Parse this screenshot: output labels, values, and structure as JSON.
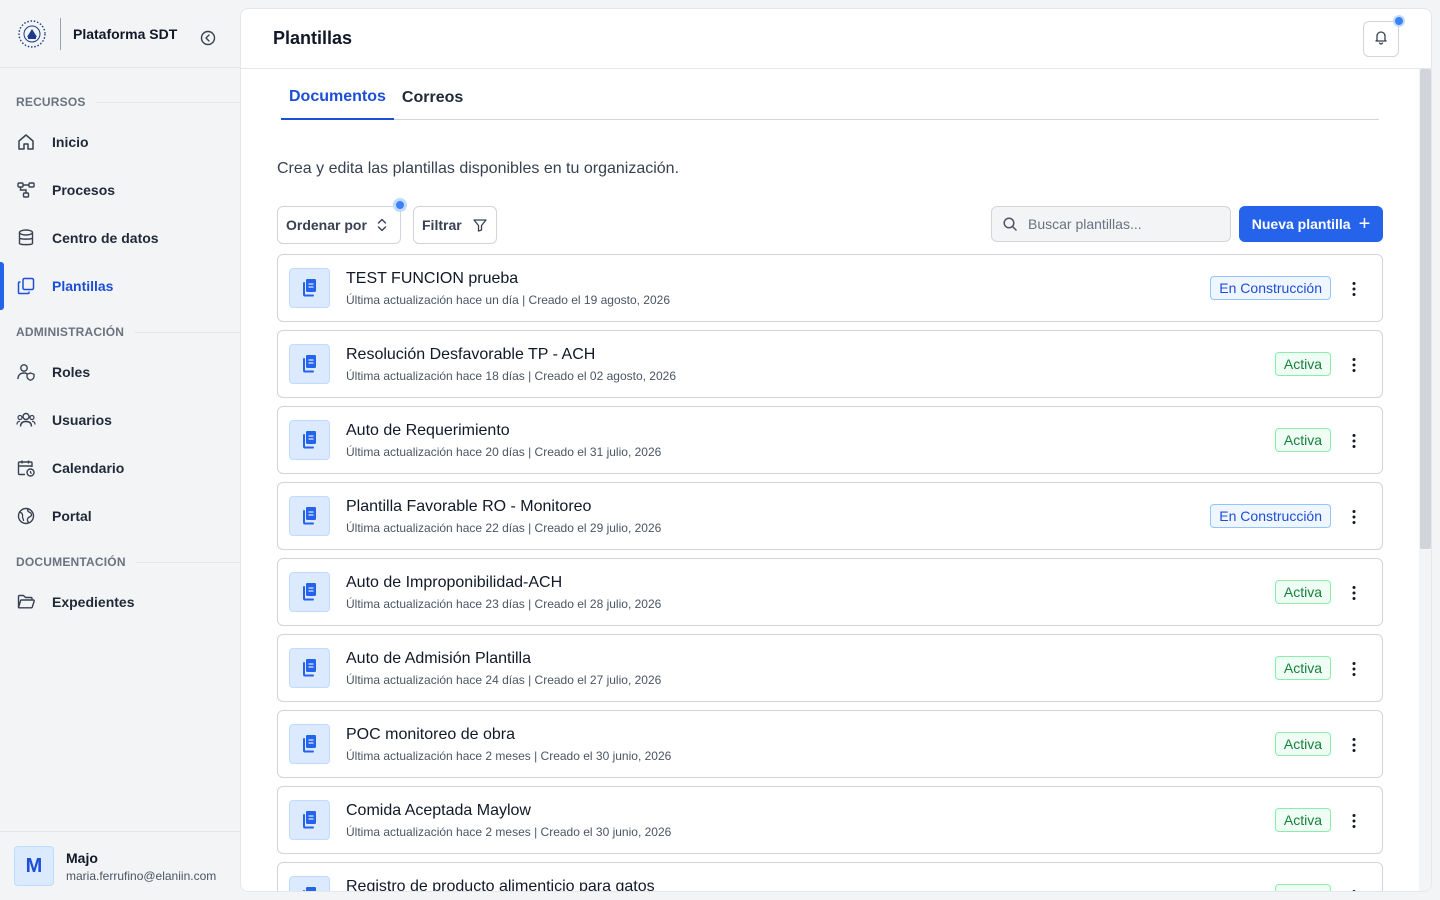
{
  "app": {
    "name": "Plataforma SDT"
  },
  "sidebar": {
    "sections": [
      {
        "label": "RECURSOS"
      },
      {
        "label": "ADMINISTRACIÓN"
      },
      {
        "label": "DOCUMENTACIÓN"
      }
    ],
    "items": [
      {
        "label": "Inicio",
        "icon": "home-icon"
      },
      {
        "label": "Procesos",
        "icon": "workflow-icon"
      },
      {
        "label": "Centro de datos",
        "icon": "database-icon"
      },
      {
        "label": "Plantillas",
        "icon": "templates-icon",
        "active": true
      },
      {
        "label": "Roles",
        "icon": "user-shield-icon"
      },
      {
        "label": "Usuarios",
        "icon": "users-icon"
      },
      {
        "label": "Calendario",
        "icon": "calendar-clock-icon"
      },
      {
        "label": "Portal",
        "icon": "globe-icon"
      },
      {
        "label": "Expedientes",
        "icon": "folder-open-icon"
      }
    ]
  },
  "user": {
    "initial": "M",
    "name": "Majo",
    "email": "maria.ferrufino@elaniin.com"
  },
  "header": {
    "title": "Plantillas"
  },
  "tabs": [
    {
      "label": "Documentos",
      "active": true
    },
    {
      "label": "Correos",
      "active": false
    }
  ],
  "description": "Crea y edita las plantillas disponibles en tu organización.",
  "toolbar": {
    "sort_label": "Ordenar por",
    "filter_label": "Filtrar",
    "search_placeholder": "Buscar plantillas...",
    "new_label": "Nueva plantilla"
  },
  "templates": [
    {
      "title": "TEST FUNCION prueba",
      "meta": "Última actualización hace un día | Creado el 19 agosto, 2026",
      "status": "En Construcción"
    },
    {
      "title": "Resolución Desfavorable TP - ACH",
      "meta": "Última actualización hace 18 días | Creado el 02 agosto, 2026",
      "status": "Activa"
    },
    {
      "title": "Auto de Requerimiento",
      "meta": "Última actualización hace 20 días | Creado el 31 julio, 2026",
      "status": "Activa"
    },
    {
      "title": "Plantilla Favorable RO - Monitoreo",
      "meta": "Última actualización hace 22 días | Creado el 29 julio, 2026",
      "status": "En Construcción"
    },
    {
      "title": "Auto de Improponibilidad-ACH",
      "meta": "Última actualización hace 23 días | Creado el 28 julio, 2026",
      "status": "Activa"
    },
    {
      "title": "Auto de Admisión Plantilla",
      "meta": "Última actualización hace 24 días | Creado el 27 julio, 2026",
      "status": "Activa"
    },
    {
      "title": "POC monitoreo de obra",
      "meta": "Última actualización hace 2 meses | Creado el 30 junio, 2026",
      "status": "Activa"
    },
    {
      "title": "Comida Aceptada Maylow",
      "meta": "Última actualización hace 2 meses | Creado el 30 junio, 2026",
      "status": "Activa"
    },
    {
      "title": "Registro de producto alimenticio para gatos",
      "meta": "",
      "status": "Activa"
    }
  ],
  "colors": {
    "accent": "#2563eb",
    "active_badge": "#15803d",
    "construction_badge": "#1d4ed8"
  }
}
